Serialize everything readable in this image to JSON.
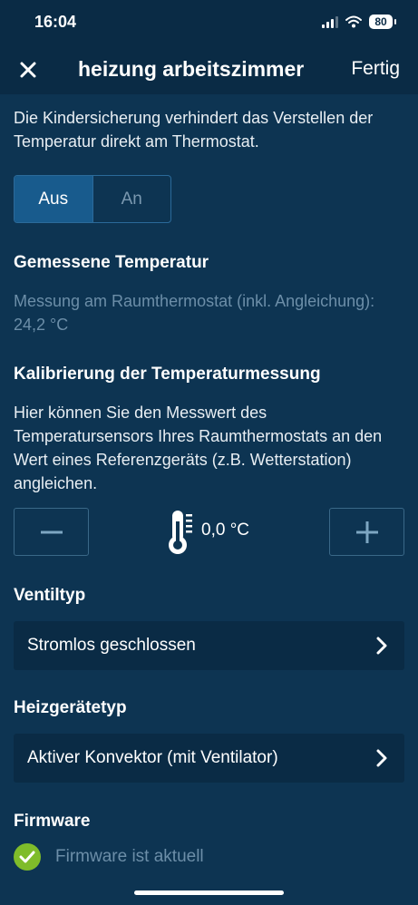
{
  "status_bar": {
    "time": "16:04",
    "battery": "80"
  },
  "header": {
    "title": "heizung arbeitszimmer",
    "done_label": "Fertig"
  },
  "child_lock": {
    "description": "Die Kindersicherung verhindert das Verstellen der Temperatur direkt am Thermostat.",
    "options": [
      "Aus",
      "An"
    ],
    "selected": "Aus"
  },
  "measured_temperature": {
    "title": "Gemessene Temperatur",
    "text": "Messung am Raumthermostat (inkl. Angleichung): 24,2 °C"
  },
  "calibration": {
    "title": "Kalibrierung der Temperaturmessung",
    "description": "Hier können Sie den Messwert des Temperatursensors Ihres Raumthermostats an den Wert eines Referenzgeräts (z.B. Wetterstation) angleichen.",
    "value": "0,0 °C"
  },
  "valve_type": {
    "title": "Ventiltyp",
    "value": "Stromlos geschlossen"
  },
  "heater_type": {
    "title": "Heizgerätetyp",
    "value": "Aktiver Konvektor (mit Ventilator)"
  },
  "firmware": {
    "title": "Firmware",
    "status": "Firmware ist aktuell"
  },
  "colors": {
    "background": "#0d3452",
    "header": "#0a2b45",
    "accent": "#185b8d",
    "muted_text": "#6c8ea8",
    "success": "#7fbc2a"
  },
  "icons": [
    "close-icon",
    "minus-icon",
    "plus-icon",
    "thermometer-icon",
    "chevron-right-icon",
    "check-icon"
  ]
}
